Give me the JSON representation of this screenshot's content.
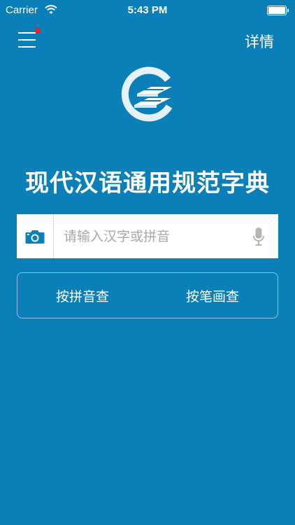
{
  "status_bar": {
    "carrier": "Carrier",
    "time": "5:43 PM"
  },
  "nav": {
    "details_label": "详情"
  },
  "app": {
    "title": "现代汉语通用规范字典"
  },
  "search": {
    "placeholder": "请输入汉字或拼音",
    "value": ""
  },
  "lookup": {
    "by_pinyin_label": "按拼音查",
    "by_stroke_label": "按笔画查"
  },
  "colors": {
    "background": "#0a7fb8",
    "accent_camera": "#0a7fb8",
    "notify_dot": "#e8202a"
  },
  "icons": {
    "menu": "hamburger-menu-icon",
    "camera": "camera-icon",
    "mic": "microphone-icon",
    "logo": "book-logo-icon",
    "wifi": "wifi-icon",
    "battery": "battery-icon"
  }
}
